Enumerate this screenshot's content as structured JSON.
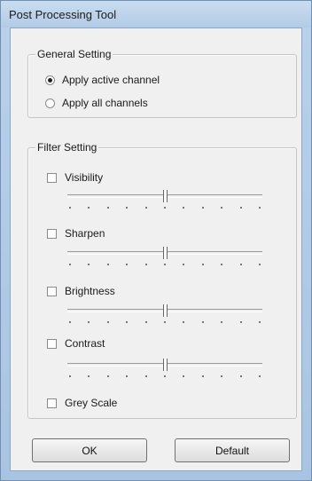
{
  "window": {
    "title": "Post Processing Tool"
  },
  "general_setting": {
    "legend": "General Setting",
    "options": [
      {
        "label": "Apply active channel",
        "selected": true
      },
      {
        "label": "Apply all channels",
        "selected": false
      }
    ]
  },
  "filter_setting": {
    "legend": "Filter Setting",
    "filters": [
      {
        "label": "Visibility",
        "checked": false,
        "slider_level": 0.5
      },
      {
        "label": "Sharpen",
        "checked": false,
        "slider_level": 0.5
      },
      {
        "label": "Brightness",
        "checked": false,
        "slider_level": 0.5
      },
      {
        "label": "Contrast",
        "checked": false,
        "slider_level": 0.5
      },
      {
        "label": "Grey Scale",
        "checked": false
      }
    ]
  },
  "buttons": {
    "ok": "OK",
    "default": "Default"
  }
}
